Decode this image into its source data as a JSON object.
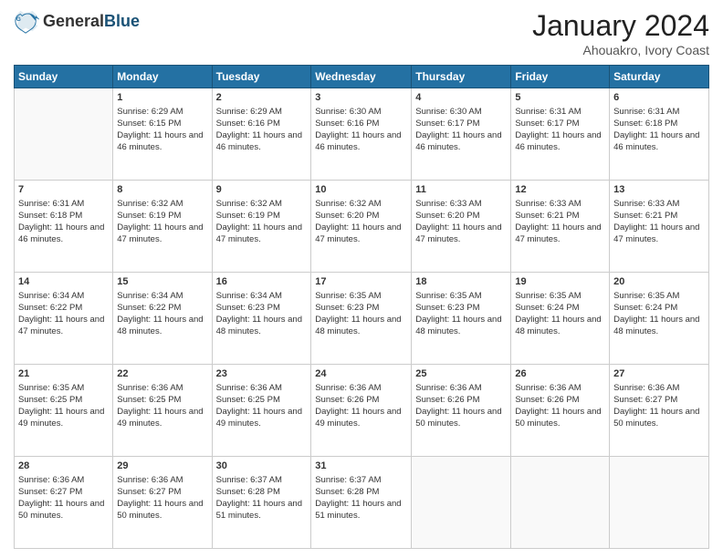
{
  "logo": {
    "general": "General",
    "blue": "Blue"
  },
  "header": {
    "month": "January 2024",
    "location": "Ahouakro, Ivory Coast"
  },
  "weekdays": [
    "Sunday",
    "Monday",
    "Tuesday",
    "Wednesday",
    "Thursday",
    "Friday",
    "Saturday"
  ],
  "weeks": [
    [
      {
        "day": "",
        "info": ""
      },
      {
        "day": "1",
        "info": "Sunrise: 6:29 AM\nSunset: 6:15 PM\nDaylight: 11 hours and 46 minutes."
      },
      {
        "day": "2",
        "info": "Sunrise: 6:29 AM\nSunset: 6:16 PM\nDaylight: 11 hours and 46 minutes."
      },
      {
        "day": "3",
        "info": "Sunrise: 6:30 AM\nSunset: 6:16 PM\nDaylight: 11 hours and 46 minutes."
      },
      {
        "day": "4",
        "info": "Sunrise: 6:30 AM\nSunset: 6:17 PM\nDaylight: 11 hours and 46 minutes."
      },
      {
        "day": "5",
        "info": "Sunrise: 6:31 AM\nSunset: 6:17 PM\nDaylight: 11 hours and 46 minutes."
      },
      {
        "day": "6",
        "info": "Sunrise: 6:31 AM\nSunset: 6:18 PM\nDaylight: 11 hours and 46 minutes."
      }
    ],
    [
      {
        "day": "7",
        "info": "Sunrise: 6:31 AM\nSunset: 6:18 PM\nDaylight: 11 hours and 46 minutes."
      },
      {
        "day": "8",
        "info": "Sunrise: 6:32 AM\nSunset: 6:19 PM\nDaylight: 11 hours and 47 minutes."
      },
      {
        "day": "9",
        "info": "Sunrise: 6:32 AM\nSunset: 6:19 PM\nDaylight: 11 hours and 47 minutes."
      },
      {
        "day": "10",
        "info": "Sunrise: 6:32 AM\nSunset: 6:20 PM\nDaylight: 11 hours and 47 minutes."
      },
      {
        "day": "11",
        "info": "Sunrise: 6:33 AM\nSunset: 6:20 PM\nDaylight: 11 hours and 47 minutes."
      },
      {
        "day": "12",
        "info": "Sunrise: 6:33 AM\nSunset: 6:21 PM\nDaylight: 11 hours and 47 minutes."
      },
      {
        "day": "13",
        "info": "Sunrise: 6:33 AM\nSunset: 6:21 PM\nDaylight: 11 hours and 47 minutes."
      }
    ],
    [
      {
        "day": "14",
        "info": "Sunrise: 6:34 AM\nSunset: 6:22 PM\nDaylight: 11 hours and 47 minutes."
      },
      {
        "day": "15",
        "info": "Sunrise: 6:34 AM\nSunset: 6:22 PM\nDaylight: 11 hours and 48 minutes."
      },
      {
        "day": "16",
        "info": "Sunrise: 6:34 AM\nSunset: 6:23 PM\nDaylight: 11 hours and 48 minutes."
      },
      {
        "day": "17",
        "info": "Sunrise: 6:35 AM\nSunset: 6:23 PM\nDaylight: 11 hours and 48 minutes."
      },
      {
        "day": "18",
        "info": "Sunrise: 6:35 AM\nSunset: 6:23 PM\nDaylight: 11 hours and 48 minutes."
      },
      {
        "day": "19",
        "info": "Sunrise: 6:35 AM\nSunset: 6:24 PM\nDaylight: 11 hours and 48 minutes."
      },
      {
        "day": "20",
        "info": "Sunrise: 6:35 AM\nSunset: 6:24 PM\nDaylight: 11 hours and 48 minutes."
      }
    ],
    [
      {
        "day": "21",
        "info": "Sunrise: 6:35 AM\nSunset: 6:25 PM\nDaylight: 11 hours and 49 minutes."
      },
      {
        "day": "22",
        "info": "Sunrise: 6:36 AM\nSunset: 6:25 PM\nDaylight: 11 hours and 49 minutes."
      },
      {
        "day": "23",
        "info": "Sunrise: 6:36 AM\nSunset: 6:25 PM\nDaylight: 11 hours and 49 minutes."
      },
      {
        "day": "24",
        "info": "Sunrise: 6:36 AM\nSunset: 6:26 PM\nDaylight: 11 hours and 49 minutes."
      },
      {
        "day": "25",
        "info": "Sunrise: 6:36 AM\nSunset: 6:26 PM\nDaylight: 11 hours and 50 minutes."
      },
      {
        "day": "26",
        "info": "Sunrise: 6:36 AM\nSunset: 6:26 PM\nDaylight: 11 hours and 50 minutes."
      },
      {
        "day": "27",
        "info": "Sunrise: 6:36 AM\nSunset: 6:27 PM\nDaylight: 11 hours and 50 minutes."
      }
    ],
    [
      {
        "day": "28",
        "info": "Sunrise: 6:36 AM\nSunset: 6:27 PM\nDaylight: 11 hours and 50 minutes."
      },
      {
        "day": "29",
        "info": "Sunrise: 6:36 AM\nSunset: 6:27 PM\nDaylight: 11 hours and 50 minutes."
      },
      {
        "day": "30",
        "info": "Sunrise: 6:37 AM\nSunset: 6:28 PM\nDaylight: 11 hours and 51 minutes."
      },
      {
        "day": "31",
        "info": "Sunrise: 6:37 AM\nSunset: 6:28 PM\nDaylight: 11 hours and 51 minutes."
      },
      {
        "day": "",
        "info": ""
      },
      {
        "day": "",
        "info": ""
      },
      {
        "day": "",
        "info": ""
      }
    ]
  ]
}
